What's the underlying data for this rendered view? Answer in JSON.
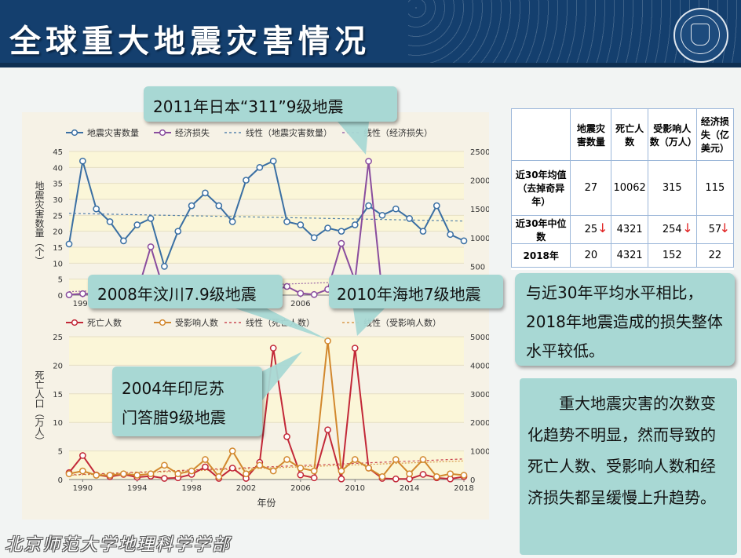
{
  "title": "全球重大地震灾害情况",
  "footer": "北京师范大学地理科学学部",
  "callouts": {
    "japan": "2011年日本“311”9级地震",
    "wenchuan": "2008年汶川7.9级地震",
    "haiti": "2010年海地7级地震",
    "sumatra_line1": "2004年印尼苏",
    "sumatra_line2": "门答腊9级地震"
  },
  "table": {
    "headers": [
      "地震灾害数量",
      "死亡人数",
      "受影响人数（万人）",
      "经济损失（亿美元）"
    ],
    "rows": [
      {
        "label": "近30年均值（去掉奇异年）",
        "values": [
          "27",
          "10062",
          "315",
          "115"
        ]
      },
      {
        "label": "近30年中位数",
        "values": [
          "25",
          "4321",
          "254",
          "57"
        ]
      },
      {
        "label": "2018年",
        "values": [
          "20",
          "4321",
          "152",
          "22"
        ]
      }
    ],
    "arrow": "↓"
  },
  "box1": "与近30年平均水平相比，2018年地震造成的损失整体水平较低。",
  "box2": "重大地震灾害的次数变化趋势不明显，然而导致的死亡人数、受影响人数和经济损失都呈缓慢上升趋势。",
  "colors": {
    "blue": "#3a6fa3",
    "purple": "#8a4d9e",
    "red": "#c22838",
    "orange": "#d2882e",
    "header": "#143f6e",
    "callout": "#a8d8d4"
  },
  "chart_data": [
    {
      "type": "line",
      "xlabel": "",
      "ylabel": "地震灾害数量（个）",
      "y2label": "地震经济损失（亿美元）",
      "x": [
        1989,
        1990,
        1991,
        1992,
        1993,
        1994,
        1995,
        1996,
        1997,
        1998,
        1999,
        2000,
        2001,
        2002,
        2003,
        2004,
        2005,
        2006,
        2007,
        2008,
        2009,
        2010,
        2011,
        2012,
        2013,
        2014,
        2015,
        2016,
        2017,
        2018
      ],
      "xticks": [
        "1990",
        "1994",
        "1998",
        "2002",
        "2006",
        "2010",
        "2014",
        "2018"
      ],
      "ylim": [
        0,
        45
      ],
      "y2lim": [
        0,
        2500
      ],
      "yticks": [
        "0",
        "5",
        "10",
        "15",
        "20",
        "25",
        "30",
        "35",
        "40",
        "45"
      ],
      "y2ticks": [
        "0",
        "500",
        "1000",
        "1500",
        "2000",
        "2500"
      ],
      "legend": [
        "地震灾害数量",
        "经济损失",
        "线性（地震灾害数量）",
        "线性（经济损失）"
      ],
      "series": [
        {
          "name": "地震灾害数量",
          "axis": "left",
          "values": [
            16,
            42,
            27,
            23,
            17,
            22,
            24,
            9,
            20,
            28,
            32,
            28,
            23,
            36,
            40,
            42,
            23,
            22,
            18,
            21,
            20,
            22,
            28,
            25,
            27,
            24,
            20,
            28,
            19,
            17
          ]
        },
        {
          "name": "经济损失",
          "axis": "right",
          "values": [
            5,
            25,
            15,
            30,
            20,
            40,
            840,
            50,
            20,
            60,
            200,
            120,
            20,
            40,
            100,
            80,
            150,
            30,
            10,
            100,
            900,
            250,
            2330,
            30,
            40,
            50,
            30,
            200,
            30,
            15
          ]
        }
      ],
      "trend": [
        {
          "name": "线性（地震灾害数量）",
          "axis": "left",
          "start": 25.6,
          "end": 23.2
        },
        {
          "name": "线性（经济损失）",
          "axis": "right",
          "start": 60,
          "end": 300
        }
      ]
    },
    {
      "type": "line",
      "xlabel": "年份",
      "ylabel": "死亡人口（万人）",
      "y2label": "受影响人数（万人）",
      "x": [
        1989,
        1990,
        1991,
        1992,
        1993,
        1994,
        1995,
        1996,
        1997,
        1998,
        1999,
        2000,
        2001,
        2002,
        2003,
        2004,
        2005,
        2006,
        2007,
        2008,
        2009,
        2010,
        2011,
        2012,
        2013,
        2014,
        2015,
        2016,
        2017,
        2018
      ],
      "xticks": [
        "1990",
        "1994",
        "1998",
        "2002",
        "2006",
        "2010",
        "2014",
        "2018"
      ],
      "ylim": [
        0,
        25
      ],
      "y2lim": [
        0,
        5000
      ],
      "yticks": [
        "0",
        "5",
        "10",
        "15",
        "20",
        "25"
      ],
      "y2ticks": [
        "0",
        "1000",
        "2000",
        "3000",
        "4000",
        "5000"
      ],
      "legend": [
        "死亡人数",
        "受影响人数",
        "线性（死亡人数）",
        "线性（受影响人数）"
      ],
      "series": [
        {
          "name": "死亡人数",
          "axis": "left",
          "values": [
            1.2,
            4.2,
            0.8,
            0.5,
            0.9,
            0.4,
            0.6,
            0.2,
            0.3,
            0.9,
            2.2,
            0.2,
            2.0,
            0.2,
            3.0,
            23.0,
            7.5,
            0.8,
            0.3,
            8.7,
            0.1,
            23.0,
            2.0,
            0.2,
            0.1,
            0.1,
            0.9,
            0.3,
            0.1,
            0.5
          ]
        },
        {
          "name": "受影响人数",
          "axis": "right",
          "values": [
            200,
            300,
            150,
            150,
            200,
            150,
            200,
            500,
            200,
            300,
            700,
            100,
            1000,
            200,
            500,
            300,
            700,
            400,
            300,
            4850,
            300,
            700,
            400,
            100,
            700,
            200,
            700,
            100,
            200,
            150
          ]
        }
      ],
      "trend": [
        {
          "name": "线性（死亡人数）",
          "axis": "left",
          "start": 0.8,
          "end": 3.6
        },
        {
          "name": "线性（受影响人数）",
          "axis": "right",
          "start": 150,
          "end": 650
        }
      ]
    }
  ]
}
